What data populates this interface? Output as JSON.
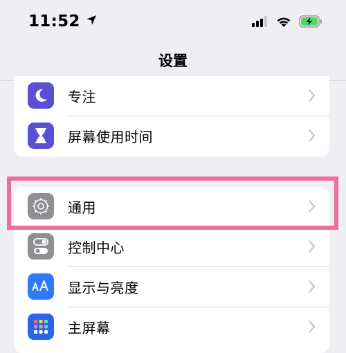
{
  "status_bar": {
    "time": "11:52"
  },
  "nav": {
    "title": "设置"
  },
  "groups": [
    {
      "items": [
        {
          "label": "专注",
          "icon": "moon-icon",
          "color": "#5b4fd3"
        },
        {
          "label": "屏幕使用时间",
          "icon": "hourglass-icon",
          "color": "#5b4fd3"
        }
      ]
    },
    {
      "items": [
        {
          "label": "通用",
          "icon": "gear-icon",
          "color": "#8e8e93"
        },
        {
          "label": "控制中心",
          "icon": "toggle-icon",
          "color": "#8e8e93"
        },
        {
          "label": "显示与亮度",
          "icon": "text-size-icon",
          "color": "#2f7bf6"
        },
        {
          "label": "主屏幕",
          "icon": "home-grid-icon",
          "color": "#2f63e6"
        }
      ]
    }
  ],
  "highlight_color": "#ee6f9a"
}
